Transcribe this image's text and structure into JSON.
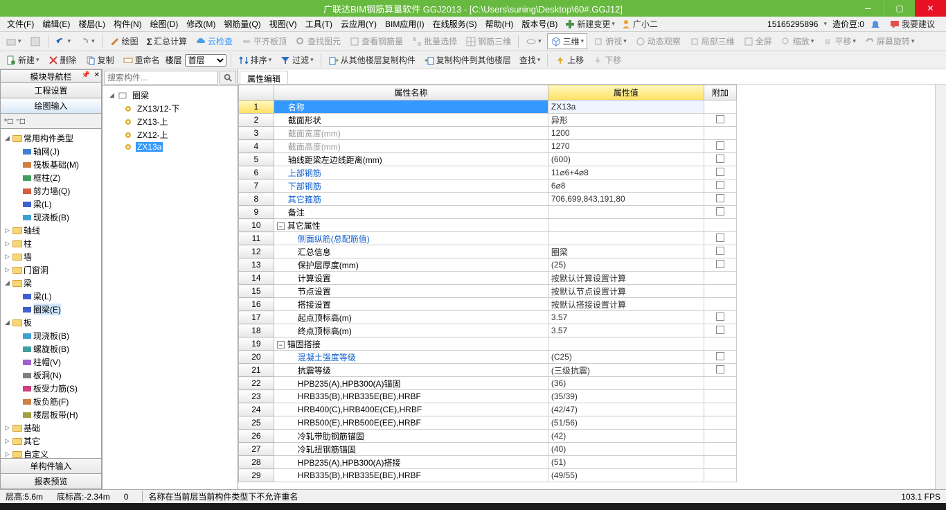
{
  "title": "广联达BIM钢筋算量软件 GGJ2013 - [C:\\Users\\suning\\Desktop\\60#.GGJ12]",
  "menu": {
    "items": [
      "文件(F)",
      "编辑(E)",
      "楼层(L)",
      "构件(N)",
      "绘图(D)",
      "修改(M)",
      "钢筋量(Q)",
      "视图(V)",
      "工具(T)",
      "云应用(Y)",
      "BIM应用(I)",
      "在线服务(S)",
      "帮助(H)",
      "版本号(B)"
    ],
    "newChange": "新建变更",
    "user": "广小二",
    "phone": "15165295896",
    "points": "造价豆:0",
    "suggest": "我要建议"
  },
  "tb1": {
    "drawing": "绘图",
    "sum": "汇总计算",
    "cloud": "云检查",
    "level": "平齐板顶",
    "findView": "查找图元",
    "viewRebar": "查看钢筋量",
    "batchSel": "批量选择",
    "rebar3d": "钢筋三维",
    "threed": "三维",
    "bird": "俯视",
    "dynamic": "动态观察",
    "local3d": "局部三维",
    "fullscreen": "全屏",
    "zoom": "缩放",
    "pan": "平移",
    "rotate": "屏幕旋转"
  },
  "tb2": {
    "new": "新建",
    "delete": "删除",
    "copy": "复制",
    "rename": "重命名",
    "floor": "楼层",
    "floorVal": "首层",
    "sort": "排序",
    "filter": "过滤",
    "copyFrom": "从其他楼层复制构件",
    "copyTo": "复制构件到其他楼层",
    "find": "查找",
    "up": "上移",
    "down": "下移"
  },
  "leftPanel": {
    "header": "模块导航栏",
    "proj": "工程设置",
    "input": "绘图输入",
    "tree": [
      {
        "label": "常用构件类型",
        "lvl": 0,
        "exp": "▢",
        "ico": "folder"
      },
      {
        "label": "轴网(J)",
        "lvl": 1,
        "ico": "grid"
      },
      {
        "label": "筏板基础(M)",
        "lvl": 1,
        "ico": "raft"
      },
      {
        "label": "框柱(Z)",
        "lvl": 1,
        "ico": "col"
      },
      {
        "label": "剪力墙(Q)",
        "lvl": 1,
        "ico": "wall"
      },
      {
        "label": "梁(L)",
        "lvl": 1,
        "ico": "beam"
      },
      {
        "label": "现浇板(B)",
        "lvl": 1,
        "ico": "slab"
      },
      {
        "label": "轴线",
        "lvl": 0,
        "exp": "▷",
        "ico": "folder"
      },
      {
        "label": "柱",
        "lvl": 0,
        "exp": "▷",
        "ico": "folder"
      },
      {
        "label": "墙",
        "lvl": 0,
        "exp": "▷",
        "ico": "folder"
      },
      {
        "label": "门窗洞",
        "lvl": 0,
        "exp": "▷",
        "ico": "folder"
      },
      {
        "label": "梁",
        "lvl": 0,
        "exp": "▢",
        "ico": "folder"
      },
      {
        "label": "梁(L)",
        "lvl": 1,
        "ico": "beam"
      },
      {
        "label": "圈梁(E)",
        "lvl": 1,
        "ico": "ring",
        "sel": true
      },
      {
        "label": "板",
        "lvl": 0,
        "exp": "▢",
        "ico": "folder"
      },
      {
        "label": "现浇板(B)",
        "lvl": 1,
        "ico": "slab"
      },
      {
        "label": "螺旋板(B)",
        "lvl": 1,
        "ico": "spiral"
      },
      {
        "label": "柱帽(V)",
        "lvl": 1,
        "ico": "cap"
      },
      {
        "label": "板洞(N)",
        "lvl": 1,
        "ico": "hole"
      },
      {
        "label": "板受力筋(S)",
        "lvl": 1,
        "ico": "sbar"
      },
      {
        "label": "板负筋(F)",
        "lvl": 1,
        "ico": "nbar"
      },
      {
        "label": "楼层板带(H)",
        "lvl": 1,
        "ico": "strip"
      },
      {
        "label": "基础",
        "lvl": 0,
        "exp": "▷",
        "ico": "folder"
      },
      {
        "label": "其它",
        "lvl": 0,
        "exp": "▷",
        "ico": "folder"
      },
      {
        "label": "自定义",
        "lvl": 0,
        "exp": "▷",
        "ico": "folder"
      }
    ],
    "single": "单构件输入",
    "report": "报表预览"
  },
  "midPanel": {
    "searchPh": "搜索构件...",
    "items": [
      {
        "label": "圈梁",
        "lvl": 0,
        "exp": "◢",
        "ico": "node"
      },
      {
        "label": "ZX13/12-下",
        "lvl": 1,
        "ico": "gear"
      },
      {
        "label": "ZX13-上",
        "lvl": 1,
        "ico": "gear"
      },
      {
        "label": "ZX12-上",
        "lvl": 1,
        "ico": "gear"
      },
      {
        "label": "ZX13a",
        "lvl": 1,
        "ico": "gear",
        "sel": true
      }
    ]
  },
  "propPanel": {
    "tab": "属性编辑",
    "cols": {
      "name": "属性名称",
      "value": "属性值",
      "attach": "附加"
    },
    "rows": [
      {
        "n": 1,
        "name": "名称",
        "val": "ZX13a",
        "sel": true
      },
      {
        "n": 2,
        "name": "截面形状",
        "val": "异形",
        "chk": true
      },
      {
        "n": 3,
        "name": "截面宽度(mm)",
        "val": "1200",
        "gray": true
      },
      {
        "n": 4,
        "name": "截面高度(mm)",
        "val": "1270",
        "gray": true,
        "chk": true
      },
      {
        "n": 5,
        "name": "轴线距梁左边线距离(mm)",
        "val": "(600)",
        "chk": true
      },
      {
        "n": 6,
        "name": "上部钢筋",
        "val": "11⌀6+4⌀8",
        "blue": true,
        "chk": true
      },
      {
        "n": 7,
        "name": "下部钢筋",
        "val": "6⌀8",
        "blue": true,
        "chk": true
      },
      {
        "n": 8,
        "name": "其它箍筋",
        "val": "706,699,843,191,80",
        "blue": true,
        "chk": true
      },
      {
        "n": 9,
        "name": "备注",
        "val": "",
        "chk": true
      },
      {
        "n": 10,
        "name": "其它属性",
        "group": true
      },
      {
        "n": 11,
        "name": "侧面纵筋(总配筋值)",
        "val": "",
        "blue": true,
        "indent": 2,
        "chk": true
      },
      {
        "n": 12,
        "name": "汇总信息",
        "val": "圈梁",
        "indent": 2,
        "chk": true
      },
      {
        "n": 13,
        "name": "保护层厚度(mm)",
        "val": "(25)",
        "indent": 2,
        "chk": true
      },
      {
        "n": 14,
        "name": "计算设置",
        "val": "按默认计算设置计算",
        "indent": 2
      },
      {
        "n": 15,
        "name": "节点设置",
        "val": "按默认节点设置计算",
        "indent": 2
      },
      {
        "n": 16,
        "name": "搭接设置",
        "val": "按默认搭接设置计算",
        "indent": 2
      },
      {
        "n": 17,
        "name": "起点顶标高(m)",
        "val": "3.57",
        "indent": 2,
        "chk": true
      },
      {
        "n": 18,
        "name": "终点顶标高(m)",
        "val": "3.57",
        "indent": 2,
        "chk": true
      },
      {
        "n": 19,
        "name": "锚固搭接",
        "group": true
      },
      {
        "n": 20,
        "name": "混凝土强度等级",
        "val": "(C25)",
        "blue": true,
        "indent": 2,
        "chk": true
      },
      {
        "n": 21,
        "name": "抗震等级",
        "val": "(三级抗震)",
        "indent": 2,
        "chk": true
      },
      {
        "n": 22,
        "name": "HPB235(A),HPB300(A)锚固",
        "val": "(36)",
        "indent": 2
      },
      {
        "n": 23,
        "name": "HRB335(B),HRB335E(BE),HRBF",
        "val": "(35/39)",
        "indent": 2
      },
      {
        "n": 24,
        "name": "HRB400(C),HRB400E(CE),HRBF",
        "val": "(42/47)",
        "indent": 2
      },
      {
        "n": 25,
        "name": "HRB500(E),HRB500E(EE),HRBF",
        "val": "(51/56)",
        "indent": 2
      },
      {
        "n": 26,
        "name": "冷轧带肋钢筋锚固",
        "val": "(42)",
        "indent": 2
      },
      {
        "n": 27,
        "name": "冷轧扭钢筋锚固",
        "val": "(40)",
        "indent": 2
      },
      {
        "n": 28,
        "name": "HPB235(A),HPB300(A)搭接",
        "val": "(51)",
        "indent": 2
      },
      {
        "n": 29,
        "name": "HRB335(B),HRB335E(BE),HRBF",
        "val": "(49/55)",
        "indent": 2
      }
    ]
  },
  "status": {
    "height": "层高:5.6m",
    "bottom": "底标高:-2.34m",
    "zero": "0",
    "hint": "名称在当前层当前构件类型下不允许重名",
    "fps": "103.1 FPS"
  }
}
